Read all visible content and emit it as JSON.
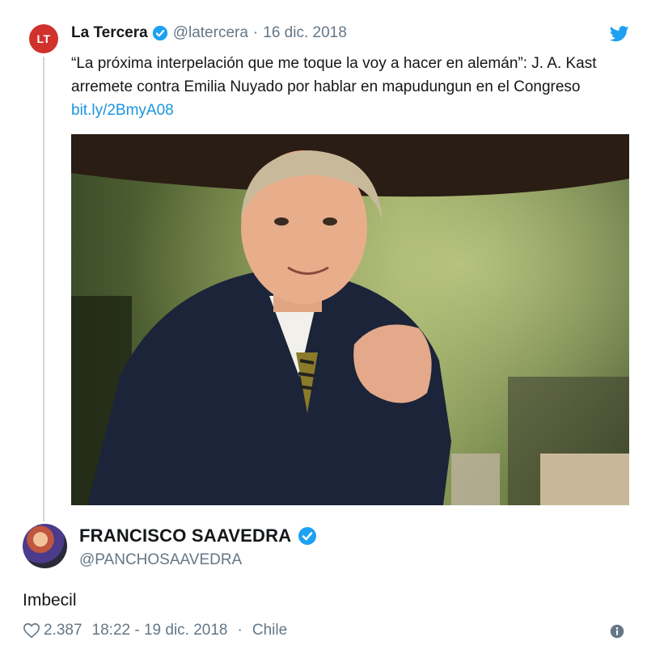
{
  "quoted_tweet": {
    "avatar_text": "LT",
    "name": "La Tercera",
    "handle": "@latercera",
    "separator": "·",
    "date": "16 dic. 2018",
    "text": "“La próxima interpelación que me toque la voy a hacer en alemán”: J. A. Kast arremete contra Emilia Nuyado por hablar en mapudungun en el Congreso",
    "link": "bit.ly/2BmyA08"
  },
  "tweet": {
    "author_name": "FRANCISCO SAAVEDRA",
    "author_handle": "@PANCHOSAAVEDRA",
    "text": "Imbecil",
    "likes": "2.387",
    "time": "18:22 - 19 dic. 2018",
    "separator": "·",
    "location": "Chile"
  },
  "icons": {
    "verified": "verified-badge-icon",
    "bird": "twitter-bird-icon",
    "heart": "heart-icon",
    "info": "info-icon"
  },
  "colors": {
    "brand_blue": "#1da1f2",
    "link_blue": "#1b95e0",
    "muted": "#657786",
    "avatar_red": "#d0312d"
  }
}
